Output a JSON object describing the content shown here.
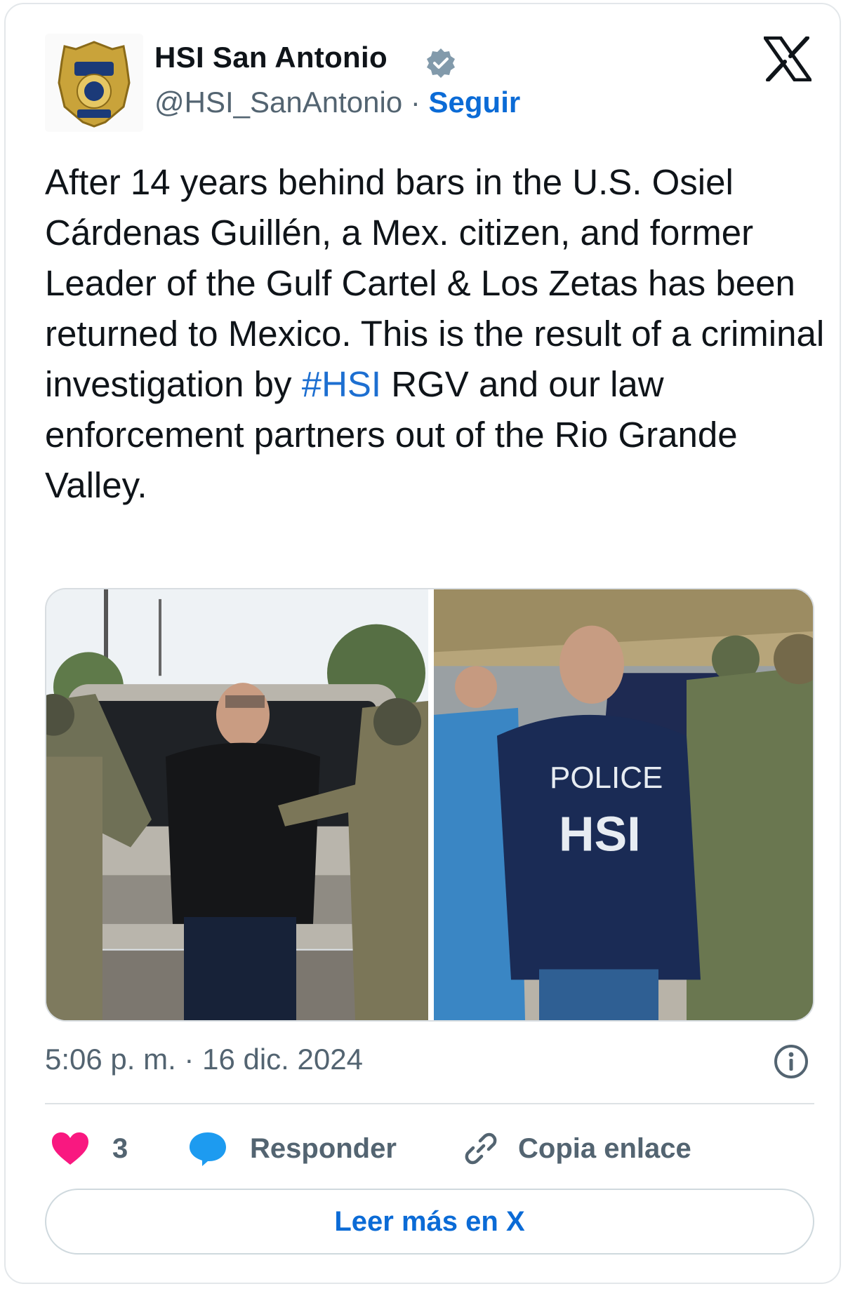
{
  "author": {
    "name": "HSI San Antonio",
    "handle": "@HSI_SanAntonio",
    "separator": "·",
    "follow_label": "Seguir",
    "avatar_icon": "hsi-badge-icon",
    "verified_icon": "verified-badge-icon"
  },
  "tweet": {
    "text_before_tag": "After 14 years behind bars in the U.S. Osiel Cárdenas Guillén, a Mex. citizen, and former Leader of the Gulf Cartel & Los Zetas has been returned to Mexico. This is the result of a criminal investigation by ",
    "hashtag": "#HSI",
    "text_after_tag": " RGV and  our law enforcement partners out of the Rio Grande Valley.",
    "timestamp": "5:06 p. m. · 16 dic. 2024"
  },
  "media": {
    "photo2_jacket_line1": "POLICE",
    "photo2_jacket_line2": "HSI"
  },
  "actions": {
    "like_count": "3",
    "reply_label": "Responder",
    "copy_link_label": "Copia enlace",
    "read_more_label": "Leer más en X"
  },
  "colors": {
    "accent": "#0b6bd6",
    "hashtag": "#1d6fd1",
    "heart": "#f91880",
    "reply_bubble": "#1d9bf0",
    "secondary_text": "#536471"
  }
}
